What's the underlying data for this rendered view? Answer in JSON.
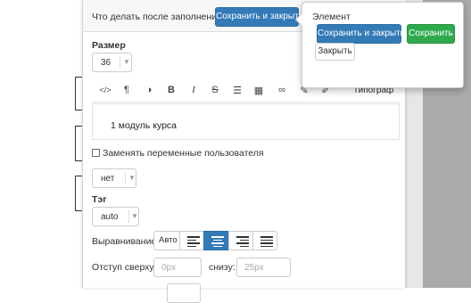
{
  "header": {
    "text": "Что делать после заполнения",
    "save_close_label": "Сохранить и закрыть"
  },
  "size": {
    "label": "Размер",
    "value": "36"
  },
  "toolbar": {
    "icons": [
      "code-icon",
      "paragraph-icon",
      "contrast-icon",
      "bold-icon",
      "italic-icon",
      "strikethrough-icon",
      "list-icon",
      "table-icon",
      "link-icon",
      "brush-icon",
      "pencil-icon"
    ],
    "typography_label": "Типограф"
  },
  "content": {
    "text": "1 модуль курса"
  },
  "replace_vars": {
    "label": "Заменять переменные пользователя",
    "value": "нет"
  },
  "tag": {
    "label": "Тэг",
    "value": "auto"
  },
  "alignment": {
    "label": "Выравнивание",
    "auto_label": "Авто",
    "active": "center"
  },
  "padding": {
    "top_label": "Отступ сверху:",
    "top_placeholder": "0px",
    "bottom_label": "снизу:",
    "bottom_placeholder": "25px"
  },
  "popover": {
    "title": "Элемент",
    "save_close_label": "Сохранить и закрыть",
    "save_label": "Сохранить",
    "close_label": "Закрыть"
  },
  "colors": {
    "primary": "#337ab7",
    "success": "#2fa94e",
    "backdrop": "#aaaaaa"
  }
}
